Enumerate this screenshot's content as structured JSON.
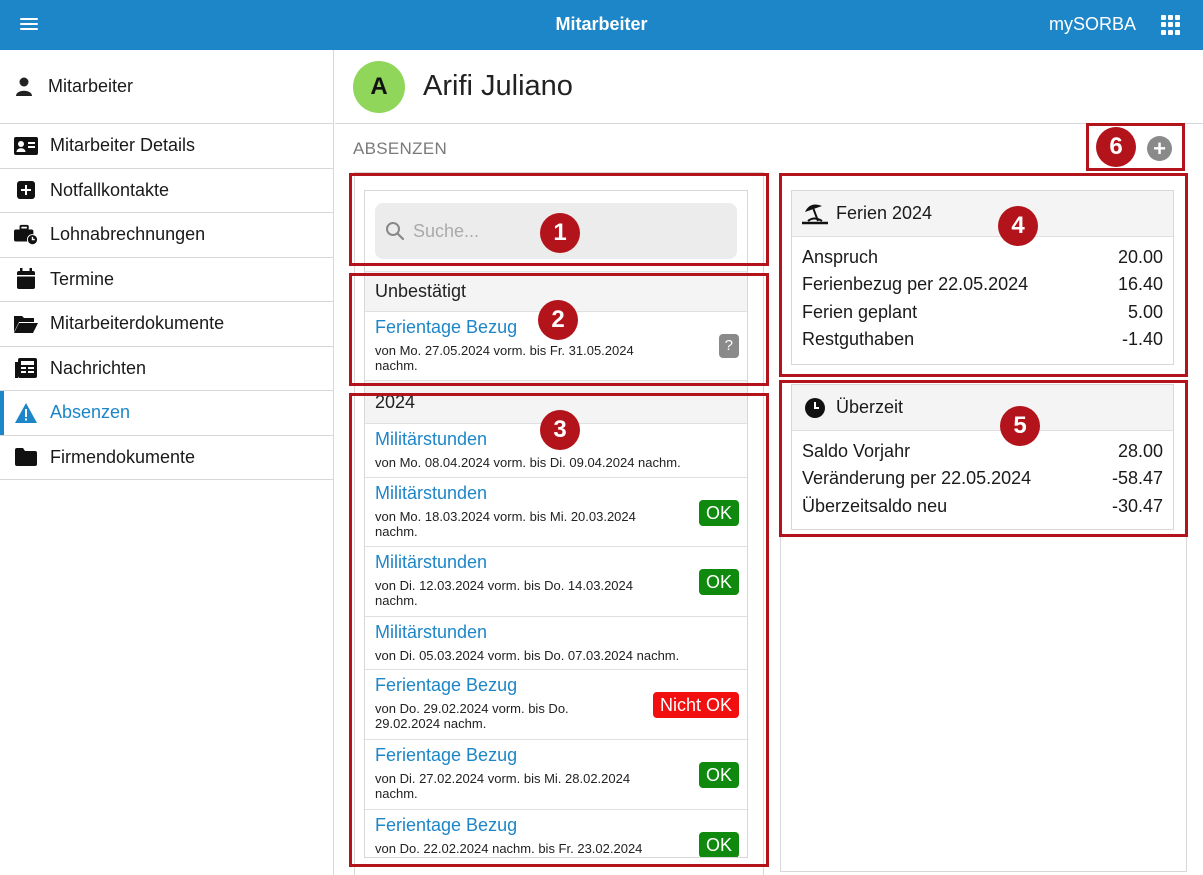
{
  "topbar": {
    "title": "Mitarbeiter",
    "brand": "mySORBA"
  },
  "sidebar": {
    "header": "Mitarbeiter",
    "items": [
      {
        "label": "Mitarbeiter Details",
        "icon": "id-card-icon"
      },
      {
        "label": "Notfallkontakte",
        "icon": "plus-square-icon"
      },
      {
        "label": "Lohnabrechnungen",
        "icon": "briefcase-clock-icon"
      },
      {
        "label": "Termine",
        "icon": "calendar-icon"
      },
      {
        "label": "Mitarbeiterdokumente",
        "icon": "folder-open-icon"
      },
      {
        "label": "Nachrichten",
        "icon": "newspaper-icon"
      },
      {
        "label": "Absenzen",
        "icon": "warning-icon",
        "active": true
      },
      {
        "label": "Firmendokumente",
        "icon": "folder-icon"
      }
    ]
  },
  "person": {
    "initial": "A",
    "name": "Arifi Juliano"
  },
  "section": {
    "title": "ABSENZEN"
  },
  "search": {
    "placeholder": "Suche..."
  },
  "pending": {
    "header": "Unbestätigt",
    "entries": [
      {
        "title": "Ferientage Bezug",
        "date": "von Mo. 27.05.2024 vorm. bis Fr. 31.05.2024 nachm.",
        "badge": "?"
      }
    ]
  },
  "year": {
    "header": "2024",
    "entries": [
      {
        "title": "Militärstunden",
        "date": "von Mo. 08.04.2024 vorm. bis Di. 09.04.2024 nachm.",
        "badge": ""
      },
      {
        "title": "Militärstunden",
        "date": "von Mo. 18.03.2024 vorm. bis Mi. 20.03.2024 nachm.",
        "badge": "OK"
      },
      {
        "title": "Militärstunden",
        "date": "von Di. 12.03.2024 vorm. bis Do. 14.03.2024 nachm.",
        "badge": "OK"
      },
      {
        "title": "Militärstunden",
        "date": "von Di. 05.03.2024 vorm. bis Do. 07.03.2024 nachm.",
        "badge": ""
      },
      {
        "title": "Ferientage Bezug",
        "date": "von Do. 29.02.2024 vorm. bis Do. 29.02.2024 nachm.",
        "badge": "Nicht OK"
      },
      {
        "title": "Ferientage Bezug",
        "date": "von Di. 27.02.2024 vorm. bis Mi. 28.02.2024 nachm.",
        "badge": "OK"
      },
      {
        "title": "Ferientage Bezug",
        "date": "von Do. 22.02.2024 nachm. bis Fr. 23.02.2024",
        "badge": "OK"
      }
    ]
  },
  "ferien": {
    "title": "Ferien 2024",
    "rows": [
      {
        "label": "Anspruch",
        "value": "20.00"
      },
      {
        "label": "Ferienbezug per 22.05.2024",
        "value": "16.40"
      },
      {
        "label": "Ferien geplant",
        "value": "5.00"
      },
      {
        "label": "Restguthaben",
        "value": "-1.40"
      }
    ]
  },
  "ueberzeit": {
    "title": "Überzeit",
    "rows": [
      {
        "label": "Saldo Vorjahr",
        "value": "28.00"
      },
      {
        "label": "Veränderung per 22.05.2024",
        "value": "-58.47"
      },
      {
        "label": "Überzeitsaldo neu",
        "value": "-30.47"
      }
    ]
  },
  "annotations": [
    "1",
    "2",
    "3",
    "4",
    "5",
    "6"
  ],
  "colors": {
    "primary": "#1d86c8",
    "ok": "#0f8a0f",
    "nok": "#f10f0f",
    "annotation": "#b3131b",
    "avatar": "#8fd65a"
  }
}
